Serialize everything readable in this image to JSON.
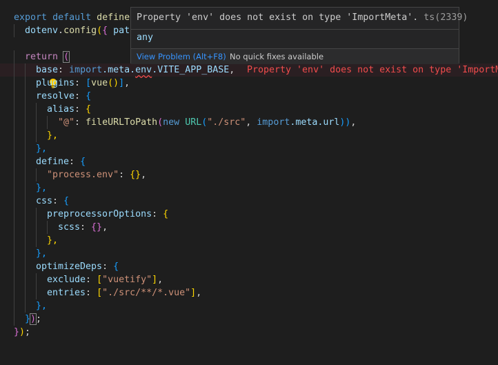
{
  "editor": {
    "lines": {
      "l1": {
        "kw1": "export",
        "kw2": "default",
        "fn": "defineC"
      },
      "l2": {
        "obj": "dotenv",
        "dot": ".",
        "fn": "config",
        "open": "(",
        "brace": "{",
        "prop": "path"
      },
      "l4": {
        "kw": "return",
        "paren": "("
      },
      "l5": {
        "prop": "base",
        "colon": ":",
        "import": "import",
        "meta": ".meta.",
        "env": "env",
        "rest": ".VITE_APP_BASE",
        "comma": ","
      },
      "l6": {
        "prop": "plugins",
        "rest1": ": ",
        "open": "[",
        "fn": "vue",
        "call": "()",
        "close": "]",
        "comma": ","
      },
      "l7": {
        "prop": "resolve",
        "rest": ": ",
        "brace": "{"
      },
      "l8": {
        "prop": "alias",
        "rest": ": ",
        "brace": "{"
      },
      "l9": {
        "key": "\"@\"",
        "colon": ": ",
        "fn": "fileURLToPath",
        "open": "(",
        "new": "new",
        "cls": "URL",
        "open2": "(",
        "str": "\"./src\"",
        "comma": ", ",
        "import": "import",
        "meta": ".meta.url",
        "close": "))",
        "comma2": ","
      },
      "l10": {
        "text": "},"
      },
      "l11": {
        "text": "},"
      },
      "l12": {
        "prop": "define",
        "rest": ": ",
        "brace": "{"
      },
      "l13": {
        "key": "\"process.env\"",
        "colon": ": ",
        "val": "{}",
        "comma": ","
      },
      "l14": {
        "text": "},"
      },
      "l15": {
        "prop": "css",
        "rest": ": ",
        "brace": "{"
      },
      "l16": {
        "prop": "preprocessorOptions",
        "rest": ": ",
        "brace": "{"
      },
      "l17": {
        "prop": "scss",
        "rest": ": ",
        "val": "{}",
        "comma": ","
      },
      "l18": {
        "text": "},"
      },
      "l19": {
        "text": "},"
      },
      "l20": {
        "prop": "optimizeDeps",
        "rest": ": ",
        "brace": "{"
      },
      "l21": {
        "prop": "exclude",
        "rest": ": ",
        "open": "[",
        "str": "\"vuetify\"",
        "close": "]",
        "comma": ","
      },
      "l22": {
        "prop": "entries",
        "rest": ": ",
        "open": "[",
        "str": "\"./src/**/*.vue\"",
        "close": "]",
        "comma": ","
      },
      "l23": {
        "text": "},"
      },
      "l24": {
        "close": "}",
        "paren": ")",
        "semi": ";"
      },
      "l25": {
        "brace": "}",
        "paren": ")",
        "semi": ";"
      }
    },
    "inline_error": "Property 'env' does not exist on type 'ImportMeta"
  },
  "hover": {
    "message": "Property 'env' does not exist on type 'ImportMeta'.",
    "code": "ts(2339)",
    "type": "any",
    "view_problem": "View Problem (Alt+F8)",
    "no_quick_fixes": "No quick fixes available"
  },
  "colors": {
    "error": "#f14c4c",
    "link": "#3794ff",
    "background": "#1e1e1e"
  }
}
